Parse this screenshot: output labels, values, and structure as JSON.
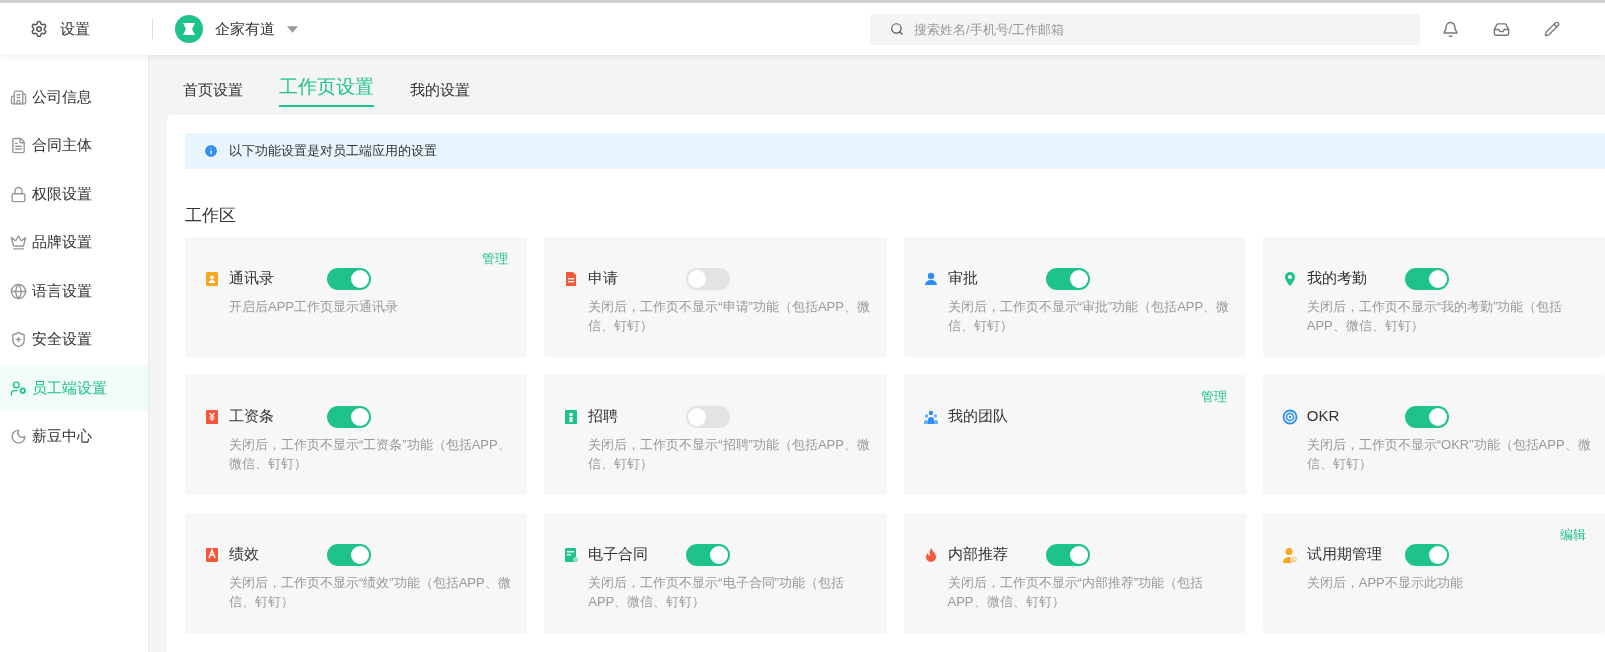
{
  "header": {
    "title": "设置",
    "company": "企家有道",
    "search": {
      "placeholder": "搜索姓名/手机号/工作邮箱"
    }
  },
  "sidebar": {
    "items": [
      {
        "label": "公司信息",
        "selected": false
      },
      {
        "label": "合同主体",
        "selected": false
      },
      {
        "label": "权限设置",
        "selected": false
      },
      {
        "label": "品牌设置",
        "selected": false
      },
      {
        "label": "语言设置",
        "selected": false
      },
      {
        "label": "安全设置",
        "selected": false
      },
      {
        "label": "员工端设置",
        "selected": true
      },
      {
        "label": "薪豆中心",
        "selected": false
      }
    ]
  },
  "tabs": [
    {
      "label": "首页设置",
      "selected": false
    },
    {
      "label": "工作页设置",
      "selected": true
    },
    {
      "label": "我的设置",
      "selected": false
    }
  ],
  "notice": "以下功能设置是对员工端应用的设置",
  "section_title": "工作区",
  "cards": [
    {
      "kind": "toggle",
      "name": "通讯录",
      "on": true,
      "description": "开启后APP工作页显示通讯录",
      "action": "管理"
    },
    {
      "kind": "toggle",
      "name": "申请",
      "on": false,
      "description": "关闭后，工作页不显示“申请”功能（包括APP、微信、钉钉）"
    },
    {
      "kind": "toggle",
      "name": "审批",
      "on": true,
      "description": "关闭后，工作页不显示“审批”功能（包括APP、微信、钉钉）"
    },
    {
      "kind": "toggle",
      "name": "我的考勤",
      "on": true,
      "description": "关闭后，工作页不显示“我的考勤”功能（包括APP、微信、钉钉）"
    },
    {
      "kind": "toggle",
      "name": "工资条",
      "on": true,
      "description": "关闭后，工作页不显示“工资条”功能（包括APP、微信、钉钉）"
    },
    {
      "kind": "toggle",
      "name": "招聘",
      "on": false,
      "description": "关闭后，工作页不显示“招聘”功能（包括APP、微信、钉钉）"
    },
    {
      "kind": "plain",
      "name": "我的团队",
      "action": "管理"
    },
    {
      "kind": "toggle",
      "name": "OKR",
      "on": true,
      "description": "关闭后，工作页不显示“OKR”功能（包括APP、微信、钉钉）"
    },
    {
      "kind": "toggle",
      "name": "绩效",
      "on": true,
      "description": "关闭后，工作页不显示“绩效”功能（包括APP、微信、钉钉）"
    },
    {
      "kind": "toggle",
      "name": "电子合同",
      "on": true,
      "description": "关闭后，工作页不显示“电子合同”功能（包括APP、微信、钉钉）"
    },
    {
      "kind": "toggle",
      "name": "内部推荐",
      "on": true,
      "description": "关闭后，工作页不显示“内部推荐”功能（包括APP、微信、钉钉）"
    },
    {
      "kind": "toggle",
      "name": "试用期管理",
      "on": true,
      "description": "关闭后，APP不显示此功能",
      "action": "编辑"
    }
  ]
}
